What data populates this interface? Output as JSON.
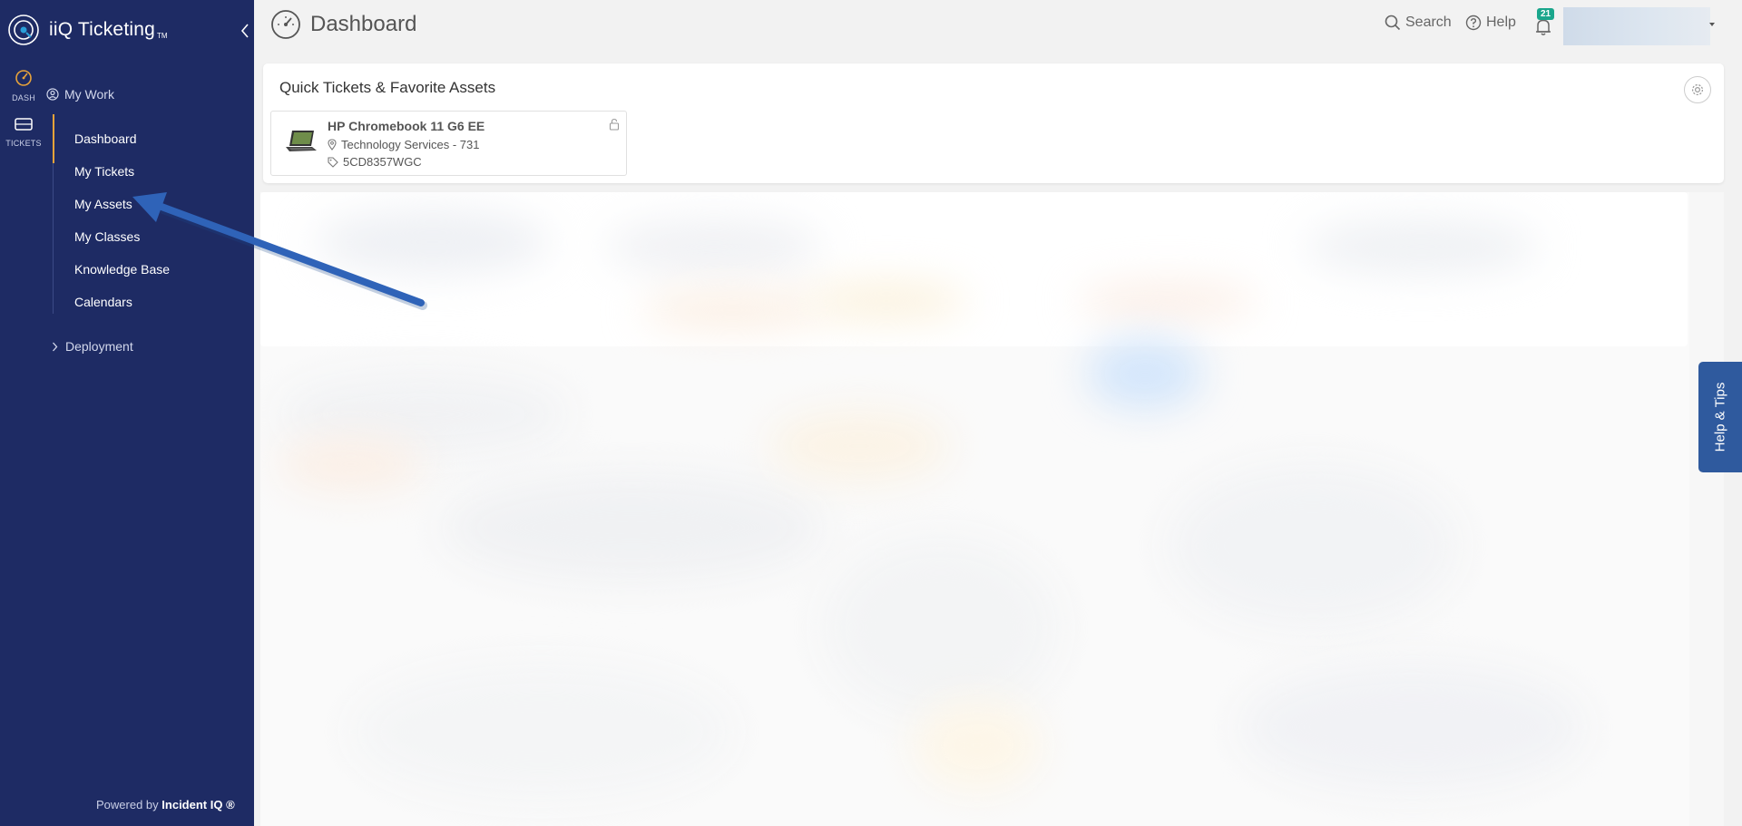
{
  "sidebar": {
    "brand": {
      "name": "iiQ Ticketing",
      "tm": "TM"
    },
    "rail": [
      {
        "label": "DASH",
        "icon": "gauge-icon"
      },
      {
        "label": "TICKETS",
        "icon": "ticket-icon"
      }
    ],
    "section": {
      "label": "My Work"
    },
    "items": [
      {
        "label": "Dashboard",
        "active": true
      },
      {
        "label": "My Tickets"
      },
      {
        "label": "My Assets"
      },
      {
        "label": "My Classes"
      },
      {
        "label": "Knowledge Base"
      },
      {
        "label": "Calendars"
      }
    ],
    "deployment": {
      "label": "Deployment"
    },
    "powered": {
      "prefix": "Powered by",
      "brand": "Incident IQ ®"
    }
  },
  "header": {
    "title": "Dashboard",
    "search_label": "Search",
    "help_label": "Help",
    "notification_count": "21"
  },
  "quick_tickets": {
    "title": "Quick Tickets & Favorite Assets",
    "assets": [
      {
        "name": "HP Chromebook 11 G6 EE",
        "location": "Technology Services - 731",
        "tag": "5CD8357WGC"
      }
    ]
  },
  "help_tab": {
    "label": "Help & Tips"
  },
  "colors": {
    "sidebar_bg": "#1e2b64",
    "active_accent": "#e8a33a",
    "badge": "#1aa68c",
    "help_tab": "#2f5a9e",
    "arrow": "#2f63b8"
  }
}
